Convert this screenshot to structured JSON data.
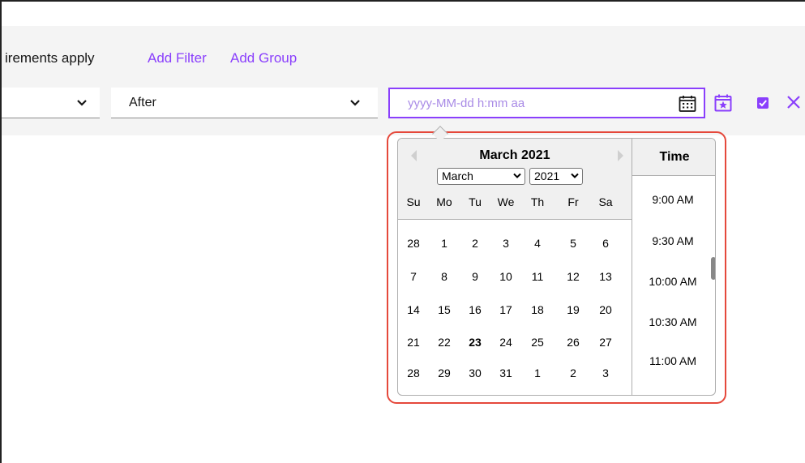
{
  "filter_bar": {
    "requirements_text": "irements apply",
    "add_filter_label": "Add Filter",
    "add_group_label": "Add Group"
  },
  "fields": {
    "first_dropdown_value": "",
    "operator_value": "After",
    "datetime_placeholder": "yyyy-MM-dd h:mm aa"
  },
  "icons": {
    "calendar": "calendar-icon",
    "event": "calendar-star-icon",
    "confirm": "checkbox-checked-icon",
    "close": "close-icon",
    "chevron": "chevron-down-icon"
  },
  "datepicker": {
    "title": "March 2021",
    "month_select": "March",
    "year_select": "2021",
    "weekdays": [
      "Su",
      "Mo",
      "Tu",
      "We",
      "Th",
      "Fr",
      "Sa"
    ],
    "weeks": [
      [
        "28",
        "1",
        "2",
        "3",
        "4",
        "5",
        "6"
      ],
      [
        "7",
        "8",
        "9",
        "10",
        "11",
        "12",
        "13"
      ],
      [
        "14",
        "15",
        "16",
        "17",
        "18",
        "19",
        "20"
      ],
      [
        "21",
        "22",
        "23",
        "24",
        "25",
        "26",
        "27"
      ],
      [
        "28",
        "29",
        "30",
        "31",
        "1",
        "2",
        "3"
      ]
    ],
    "today": "23",
    "time_title": "Time",
    "times": [
      "9:00 AM",
      "9:30 AM",
      "10:00 AM",
      "10:30 AM",
      "11:00 AM"
    ]
  },
  "colors": {
    "accent": "#8a3ffc",
    "highlight": "#e5483b",
    "band": "#f4f4f4"
  }
}
